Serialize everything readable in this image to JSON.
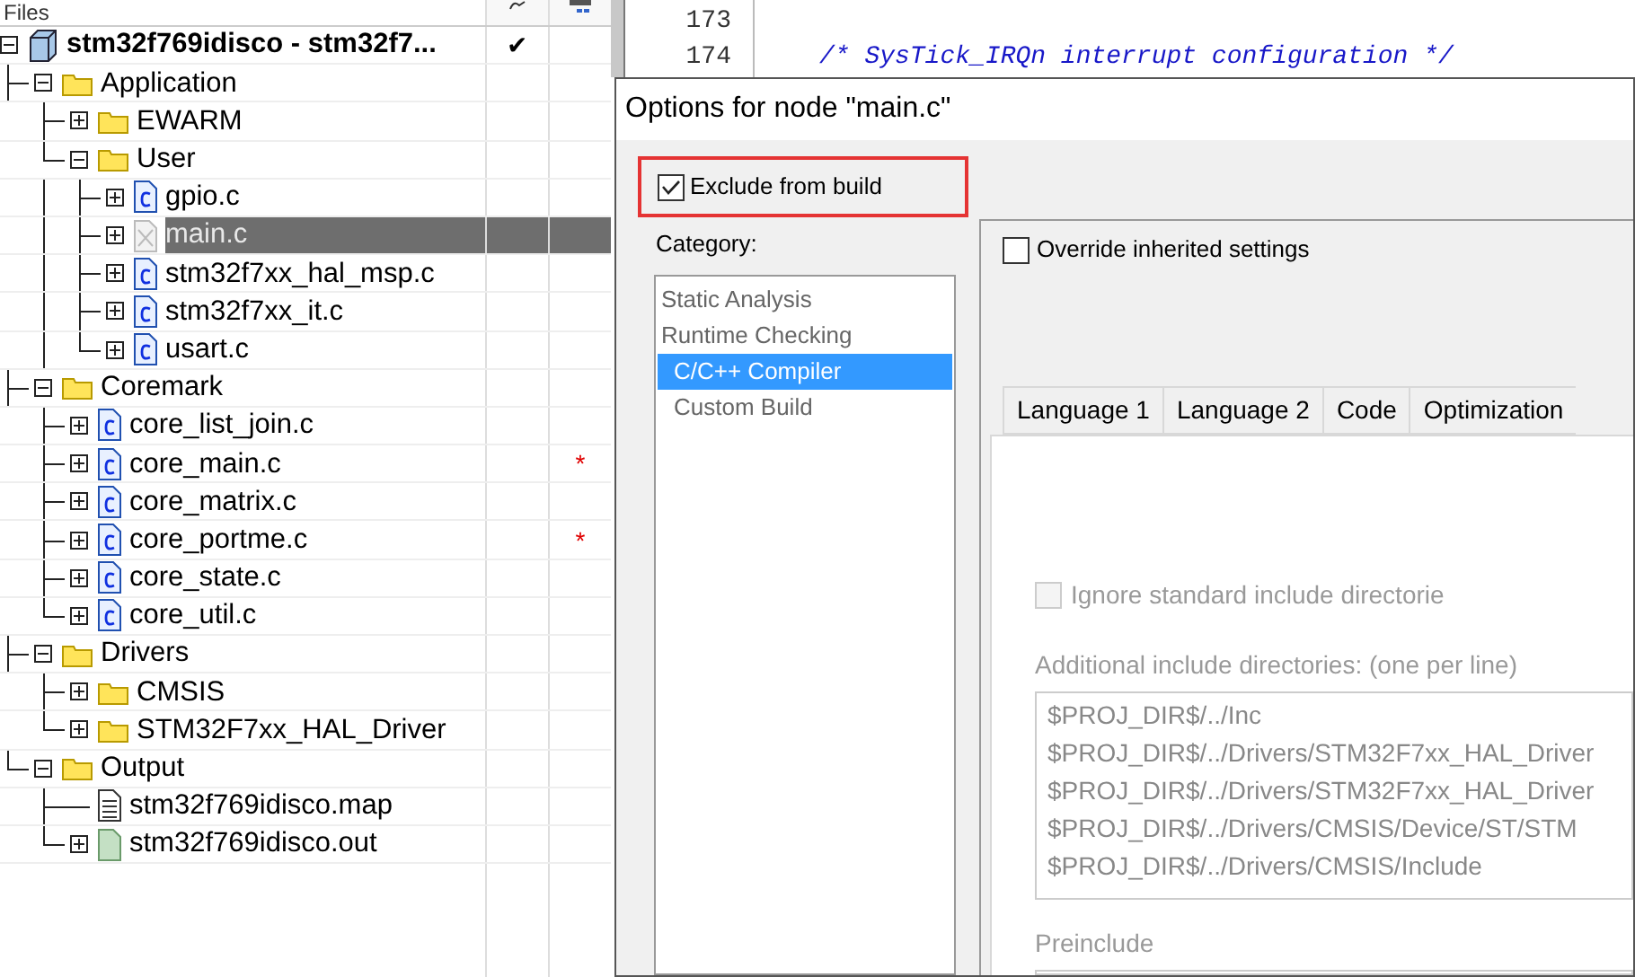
{
  "file_panel": {
    "header": "Files",
    "root": {
      "label": "stm32f769idisco - stm32f7...",
      "kind": "project",
      "expanded": true,
      "selected": false,
      "column_1": "✔",
      "children": [
        {
          "label": "Application",
          "kind": "folder",
          "expanded": true,
          "selected": false,
          "children": [
            {
              "label": "EWARM",
              "kind": "folder",
              "expanded": false,
              "selected": false
            },
            {
              "label": "User",
              "kind": "folder",
              "expanded": true,
              "selected": false,
              "children": [
                {
                  "label": "gpio.c",
                  "kind": "c-file",
                  "expanded": false,
                  "selected": false
                },
                {
                  "label": "main.c",
                  "kind": "excluded-file",
                  "expanded": false,
                  "selected": true
                },
                {
                  "label": "stm32f7xx_hal_msp.c",
                  "kind": "c-file",
                  "expanded": false,
                  "selected": false
                },
                {
                  "label": "stm32f7xx_it.c",
                  "kind": "c-file",
                  "expanded": false,
                  "selected": false
                },
                {
                  "label": "usart.c",
                  "kind": "c-file",
                  "expanded": false,
                  "selected": false
                }
              ]
            }
          ]
        },
        {
          "label": "Coremark",
          "kind": "folder",
          "expanded": true,
          "selected": false,
          "children": [
            {
              "label": "core_list_join.c",
              "kind": "c-file",
              "expanded": false,
              "selected": false
            },
            {
              "label": "core_main.c",
              "kind": "c-file",
              "expanded": false,
              "selected": false,
              "column_2": "*"
            },
            {
              "label": "core_matrix.c",
              "kind": "c-file",
              "expanded": false,
              "selected": false
            },
            {
              "label": "core_portme.c",
              "kind": "c-file",
              "expanded": false,
              "selected": false,
              "column_2": "*"
            },
            {
              "label": "core_state.c",
              "kind": "c-file",
              "expanded": false,
              "selected": false
            },
            {
              "label": "core_util.c",
              "kind": "c-file",
              "expanded": false,
              "selected": false
            }
          ]
        },
        {
          "label": "Drivers",
          "kind": "folder",
          "expanded": true,
          "selected": false,
          "children": [
            {
              "label": "CMSIS",
              "kind": "folder",
              "expanded": false,
              "selected": false
            },
            {
              "label": "STM32F7xx_HAL_Driver",
              "kind": "folder",
              "expanded": false,
              "selected": false
            }
          ]
        },
        {
          "label": "Output",
          "kind": "folder",
          "expanded": true,
          "selected": false,
          "children": [
            {
              "label": "stm32f769idisco.map",
              "kind": "map-file",
              "selected": false
            },
            {
              "label": "stm32f769idisco.out",
              "kind": "out-file",
              "expanded": false,
              "selected": false
            }
          ]
        }
      ]
    }
  },
  "editor": {
    "lines": [
      {
        "number": "173"
      },
      {
        "number": "174",
        "code": "/* SysTick_IRQn interrupt configuration */"
      }
    ]
  },
  "dialog": {
    "title": "Options for node \"main.c\"",
    "exclude_from_build": {
      "label": "Exclude from build",
      "checked": true,
      "highlighted": true
    },
    "category_label": "Category:",
    "categories": [
      {
        "label": "Static Analysis",
        "selected": false,
        "indented": false
      },
      {
        "label": "Runtime Checking",
        "selected": false,
        "indented": false
      },
      {
        "label": "C/C++ Compiler",
        "selected": true,
        "indented": true
      },
      {
        "label": "Custom Build",
        "selected": false,
        "indented": true
      }
    ],
    "override": {
      "label": "Override inherited settings",
      "checked": false
    },
    "tabs": [
      {
        "label": "Language 1",
        "selected": false
      },
      {
        "label": "Language 2",
        "selected": false
      },
      {
        "label": "Code",
        "selected": false
      },
      {
        "label": "Optimization",
        "selected": false
      }
    ],
    "ignore_standard": {
      "label": "Ignore standard include directorie",
      "checked": false,
      "disabled": true
    },
    "include_label": "Additional include directories: (one per line)",
    "include_dirs": [
      "$PROJ_DIR$/../Inc",
      "$PROJ_DIR$/../Drivers/STM32F7xx_HAL_Driver",
      "$PROJ_DIR$/../Drivers/STM32F7xx_HAL_Driver",
      "$PROJ_DIR$/../Drivers/CMSIS/Device/ST/STM",
      "$PROJ_DIR$/../Drivers/CMSIS/Include"
    ],
    "preinclude_label": "Preinclude"
  }
}
